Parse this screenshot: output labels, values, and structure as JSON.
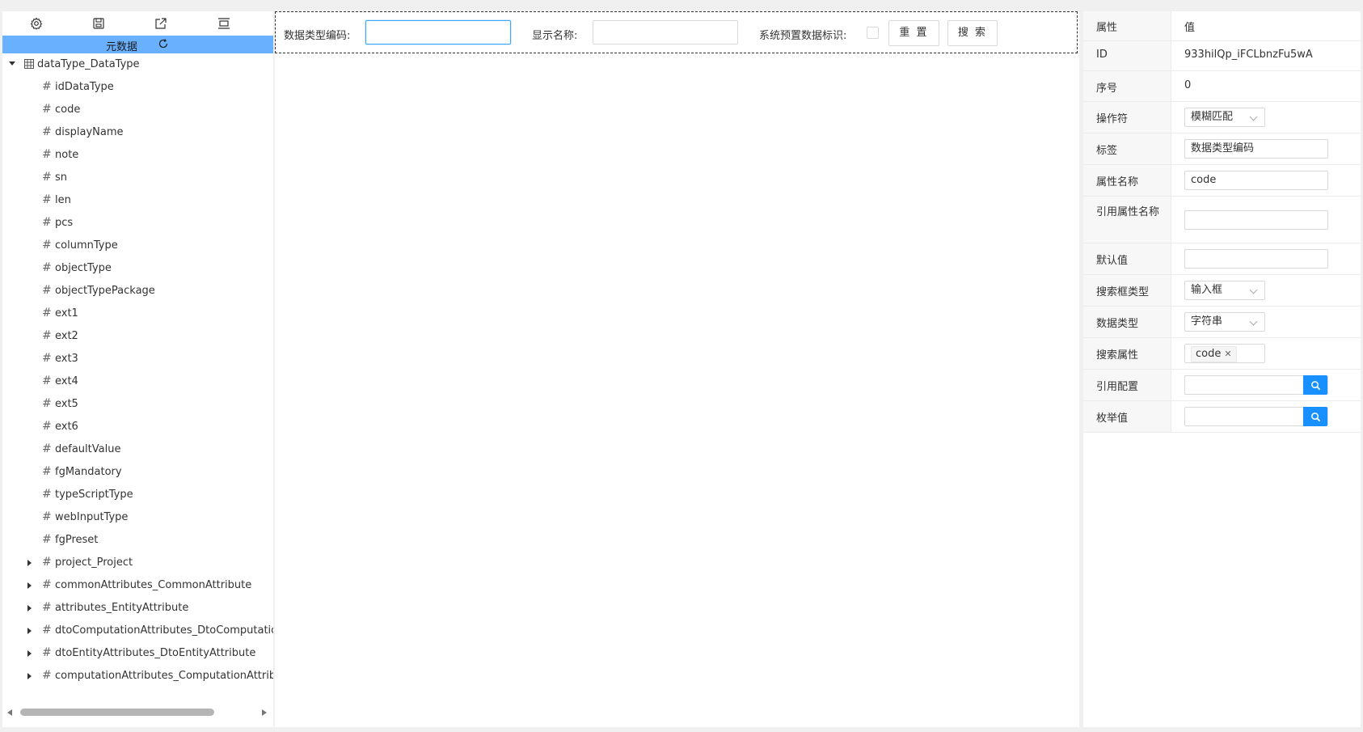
{
  "toolbar": {
    "icons": [
      "gear-icon",
      "save-icon",
      "export-icon",
      "layout-icon"
    ]
  },
  "meta": {
    "title": "元数据",
    "refresh_icon": "refresh-icon"
  },
  "tree": {
    "root": {
      "label": "dataType_DataType",
      "icon": "table-icon"
    },
    "children": [
      "idDataType",
      "code",
      "displayName",
      "note",
      "sn",
      "len",
      "pcs",
      "columnType",
      "objectType",
      "objectTypePackage",
      "ext1",
      "ext2",
      "ext3",
      "ext4",
      "ext5",
      "ext6",
      "defaultValue",
      "fgMandatory",
      "typeScriptType",
      "webInputType",
      "fgPreset"
    ],
    "collapsed": [
      "project_Project",
      "commonAttributes_CommonAttribute",
      "attributes_EntityAttribute",
      "dtoComputationAttributes_DtoComputatio",
      "dtoEntityAttributes_DtoEntityAttribute",
      "computationAttributes_ComputationAttribu"
    ]
  },
  "search": {
    "code_label": "数据类型编码:",
    "code_value": "",
    "name_label": "显示名称:",
    "name_value": "",
    "preset_label": "系统预置数据标识:",
    "reset_label": "重 置",
    "search_label": "搜 索"
  },
  "props": {
    "header_key": "属性",
    "header_val": "值",
    "id_key": "ID",
    "id_val": "933hilQp_iFCLbnzFu5wA",
    "sn_key": "序号",
    "sn_val": "0",
    "op_key": "操作符",
    "op_val": "模糊匹配",
    "tag_key": "标签",
    "tag_val": "数据类型编码",
    "attr_key": "属性名称",
    "attr_val": "code",
    "ref_attr_key": "引用属性名称",
    "ref_attr_val": "",
    "default_key": "默认值",
    "default_val": "",
    "box_type_key": "搜索框类型",
    "box_type_val": "输入框",
    "data_type_key": "数据类型",
    "data_type_val": "字符串",
    "search_attr_key": "搜索属性",
    "search_attr_tag": "code",
    "ref_config_key": "引用配置",
    "ref_config_val": "",
    "enum_key": "枚举值",
    "enum_val": ""
  }
}
